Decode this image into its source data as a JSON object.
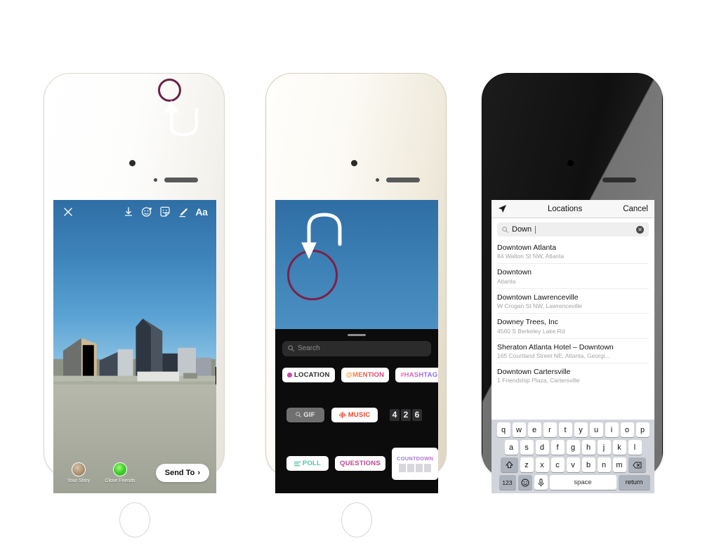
{
  "phone1": {
    "name": "instagram-story-composer",
    "toolbar": {
      "close_icon": "close-icon",
      "download_icon": "download-icon",
      "effects_icon": "effects-face-icon",
      "sticker_icon": "sticker-smiley-icon",
      "draw_icon": "pen-draw-icon",
      "text_label": "Aa"
    },
    "bottom": {
      "your_story_label": "Your Story",
      "close_friends_label": "Close Friends",
      "send_to_label": "Send To",
      "send_to_chevron": "›"
    },
    "annotation": {
      "color": "#6b2147",
      "shape": "circle-with-curved-arrow"
    }
  },
  "phone2": {
    "name": "instagram-sticker-tray",
    "search": {
      "placeholder": "Search",
      "icon": "search-icon"
    },
    "grabber": "drag-handle",
    "stickers_row1": [
      {
        "id": "location",
        "label": "LOCATION",
        "icon": "location-pin-icon"
      },
      {
        "id": "mention",
        "label": "@MENTION"
      },
      {
        "id": "hashtag",
        "label": "#HASHTAG"
      }
    ],
    "stickers_row2": [
      {
        "id": "gif",
        "label": "GIF",
        "icon": "search-icon"
      },
      {
        "id": "music",
        "label": "MUSIC",
        "icon": "music-wave-icon"
      },
      {
        "id": "clock",
        "label": "426",
        "digits": [
          "4",
          "2",
          "6"
        ]
      }
    ],
    "stickers_row3": [
      {
        "id": "poll",
        "label": "POLL",
        "icon": "poll-bars-icon"
      },
      {
        "id": "questions",
        "label": "QUESTIONS"
      },
      {
        "id": "countdown",
        "label": "COUNTDOWN"
      }
    ],
    "annotation": {
      "color": "#7d2046",
      "shape": "circle-with-curved-arrow"
    }
  },
  "phone3": {
    "name": "instagram-location-search",
    "nav": {
      "location_icon": "navigation-arrow-icon",
      "title": "Locations",
      "cancel_label": "Cancel"
    },
    "search": {
      "icon": "search-icon",
      "value": "Down",
      "clear_icon": "clear-circle-icon"
    },
    "results": [
      {
        "name": "Downtown Atlanta",
        "address": "84 Walton St NW, Atlanta"
      },
      {
        "name": "Downtown",
        "address": "Atlanta"
      },
      {
        "name": "Downtown Lawrenceville",
        "address": "W Crogan St NW, Lawrenceville"
      },
      {
        "name": "Downey Trees, Inc",
        "address": "4560 S Berkeley Lake Rd"
      },
      {
        "name": "Sheraton Atlanta Hotel – Downtown",
        "address": "165 Courtland Street NE, Atlanta, Georgi..."
      },
      {
        "name": "Downtown Cartersville",
        "address": "1 Friendship Plaza, Cartersville"
      }
    ],
    "keyboard": {
      "row1": [
        "q",
        "w",
        "e",
        "r",
        "t",
        "y",
        "u",
        "i",
        "o",
        "p"
      ],
      "row2": [
        "a",
        "s",
        "d",
        "f",
        "g",
        "h",
        "j",
        "k",
        "l"
      ],
      "row3": [
        "z",
        "x",
        "c",
        "v",
        "b",
        "n",
        "m"
      ],
      "shift_icon": "shift-up-icon",
      "backspace_icon": "backspace-icon",
      "numbers_label": "123",
      "emoji_icon": "emoji-smiley-icon",
      "mic_icon": "microphone-icon",
      "space_label": "space",
      "return_label": "return"
    }
  }
}
